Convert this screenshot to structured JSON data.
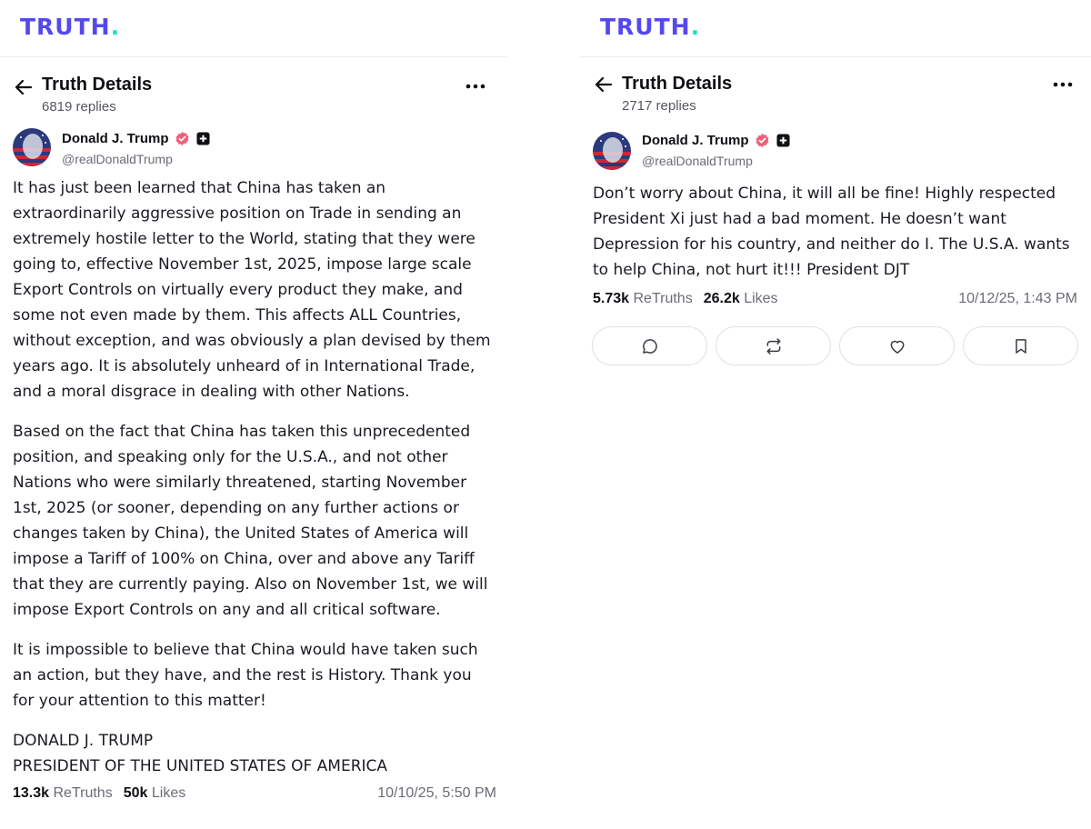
{
  "brand": {
    "logo_text": "TRUTH",
    "logo_dot": ".",
    "logo_color": "#5448ee",
    "dot_color": "#17e2c7"
  },
  "left": {
    "header": {
      "title": "Truth Details",
      "replies": "6819 replies"
    },
    "author": {
      "name": "Donald J. Trump",
      "handle": "@realDonaldTrump"
    },
    "paragraphs": [
      "It has just been learned that China has taken an extraordinarily aggressive position on Trade in sending an extremely hostile letter to the World, stating that they were going to, effective November 1st, 2025, impose large scale Export Controls on virtually every product they make, and some not even made by them. This affects ALL Countries, without exception, and was obviously a plan devised by them years ago. It is absolutely unheard of in International Trade, and a moral disgrace in dealing with other Nations.",
      "Based on the fact that China has taken this unprecedented position, and speaking only for the U.S.A., and not other Nations who were similarly threatened, starting November 1st, 2025 (or sooner, depending on any further actions or changes taken by China), the United States of America will impose a Tariff of 100% on China, over and above any Tariff that they are currently paying. Also on November 1st, we will impose Export Controls on any and all critical software.",
      "It is impossible to believe that China would have taken such an action, but they have, and the rest is History. Thank you for your attention to this matter!"
    ],
    "signature_line1": "DONALD J. TRUMP",
    "signature_line2": "PRESIDENT OF THE UNITED STATES OF AMERICA",
    "stats": {
      "retruths_count": "13.3k",
      "retruths_label": "ReTruths",
      "likes_count": "50k",
      "likes_label": "Likes",
      "timestamp": "10/10/25, 5:50 PM"
    }
  },
  "right": {
    "header": {
      "title": "Truth Details",
      "replies": "2717 replies"
    },
    "author": {
      "name": "Donald J. Trump",
      "handle": "@realDonaldTrump"
    },
    "paragraphs": [
      "Don’t worry about China, it will all be fine! Highly respected President Xi just had a bad moment. He doesn’t want Depression for his country, and neither do I. The U.S.A. wants to help China, not hurt it!!!  President DJT"
    ],
    "stats": {
      "retruths_count": "5.73k",
      "retruths_label": "ReTruths",
      "likes_count": "26.2k",
      "likes_label": "Likes",
      "timestamp": "10/12/25, 1:43 PM"
    },
    "actions": [
      {
        "icon": "reply-icon"
      },
      {
        "icon": "retruth-icon"
      },
      {
        "icon": "like-icon"
      },
      {
        "icon": "bookmark-icon"
      }
    ]
  }
}
